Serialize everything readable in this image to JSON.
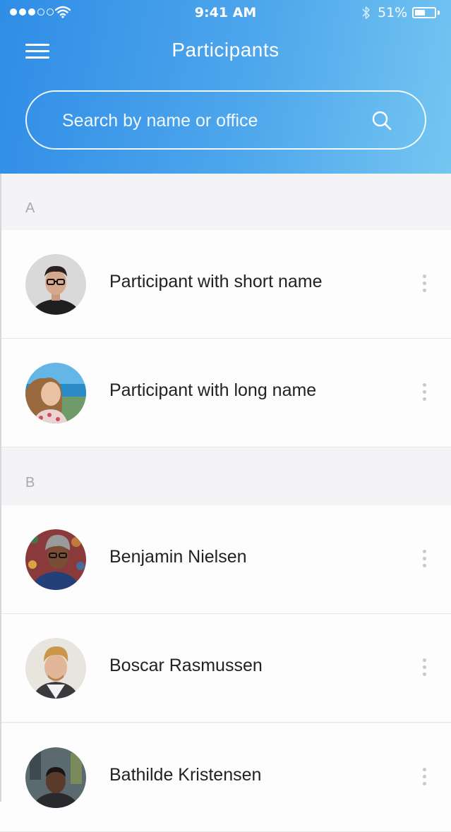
{
  "status_bar": {
    "time": "9:41 AM",
    "battery": "51%",
    "signal_icon": "signal-dots-icon",
    "wifi_icon": "wifi-icon",
    "bluetooth_icon": "bluetooth-icon"
  },
  "header": {
    "title": "Participants",
    "menu_icon": "hamburger-menu-icon",
    "gradient_colors": [
      "#2f8de6",
      "#74c6f1"
    ]
  },
  "search": {
    "placeholder": "Search by name or office",
    "value": "",
    "icon": "search-icon"
  },
  "sections": [
    {
      "letter": "A",
      "participants": [
        {
          "name": "Participant with short name"
        },
        {
          "name": "Participant with long name"
        }
      ]
    },
    {
      "letter": "B",
      "participants": [
        {
          "name": "Benjamin Nielsen"
        },
        {
          "name": "Boscar Rasmussen"
        },
        {
          "name": "Bathilde Kristensen"
        }
      ]
    }
  ]
}
